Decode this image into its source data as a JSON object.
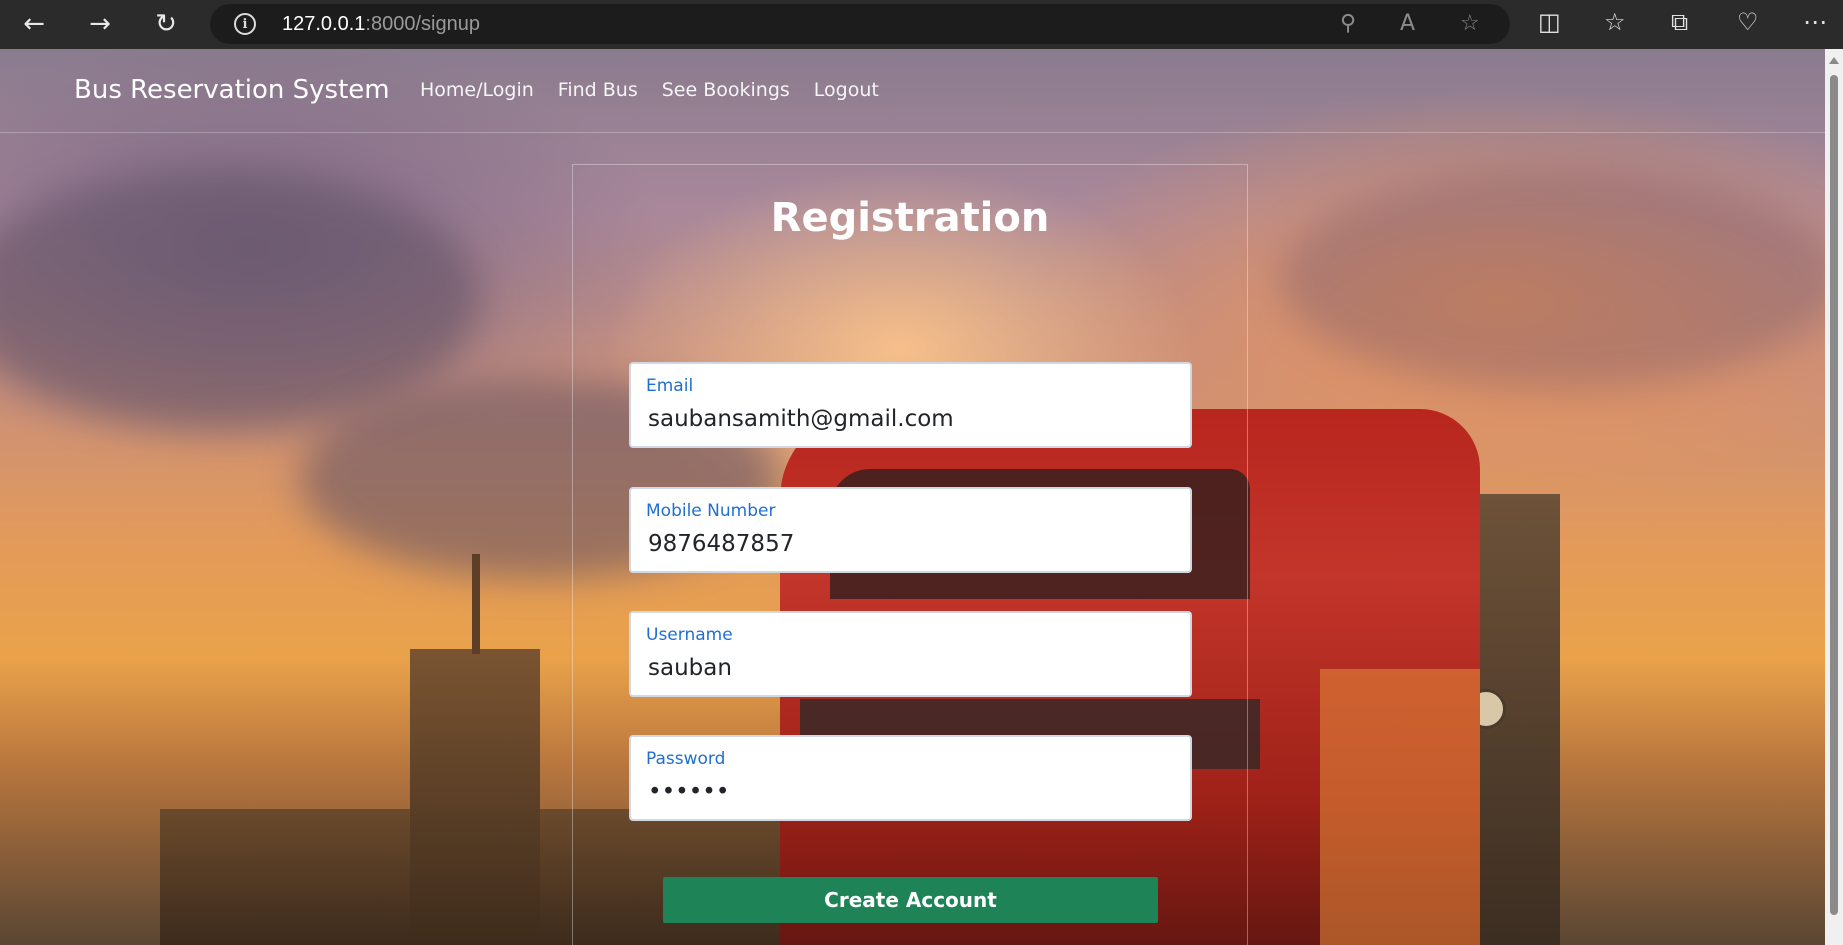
{
  "browser": {
    "url_host": "127.0.0.1",
    "url_path": ":8000/signup",
    "icons": [
      "back-arrow-icon",
      "forward-arrow-icon",
      "refresh-icon",
      "site-info-icon",
      "key-icon",
      "read-aloud-icon",
      "favorite-star-icon",
      "split-screen-icon",
      "favorites-icon",
      "collections-icon",
      "browser-essentials-icon",
      "more-menu-icon"
    ]
  },
  "navbar": {
    "brand": "Bus Reservation System",
    "links": [
      "Home/Login",
      "Find Bus",
      "See Bookings",
      "Logout"
    ]
  },
  "form": {
    "title": "Registration",
    "fields": [
      {
        "label": "Email",
        "value": "saubansamith@gmail.com"
      },
      {
        "label": "Mobile Number",
        "value": "9876487857"
      },
      {
        "label": "Username",
        "value": "sauban"
      },
      {
        "label": "Password",
        "value": "••••••"
      }
    ],
    "submit_label": "Create Account"
  },
  "colors": {
    "button": "#1e8457",
    "field_label": "#1f6fd1",
    "chrome": "#2b2b2b"
  }
}
